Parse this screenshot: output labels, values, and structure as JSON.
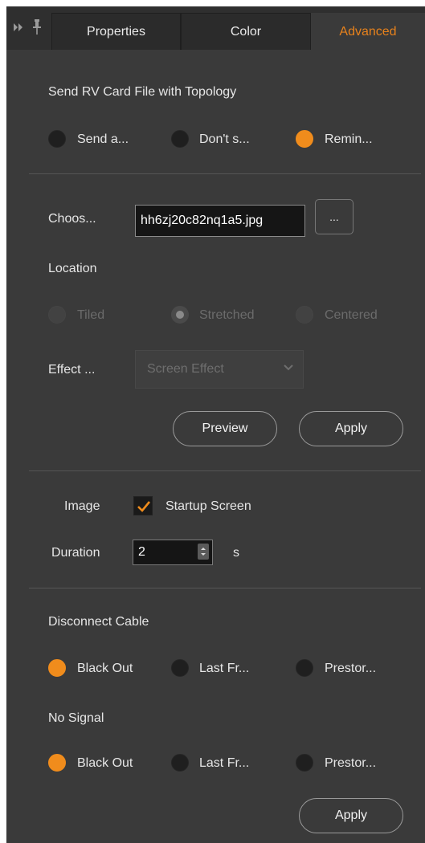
{
  "tabs": [
    {
      "label": "Properties"
    },
    {
      "label": "Color"
    },
    {
      "label": "Advanced"
    }
  ],
  "colors": {
    "accent": "#f08c1c",
    "panel": "#3a3a3a",
    "tab_active_text": "#e8821c"
  },
  "topology": {
    "heading": "Send RV Card File with Topology",
    "options": [
      {
        "label": "Send a...",
        "selected": false
      },
      {
        "label": "Don't s...",
        "selected": false
      },
      {
        "label": "Remin...",
        "selected": true
      }
    ]
  },
  "file": {
    "label": "Choos...",
    "value": "hh6zj20c82nq1a5.jpg",
    "browse_label": "..."
  },
  "location": {
    "heading": "Location",
    "options": [
      {
        "label": "Tiled",
        "selected": false,
        "enabled": false
      },
      {
        "label": "Stretched",
        "selected": true,
        "enabled": false
      },
      {
        "label": "Centered",
        "selected": false,
        "enabled": false
      }
    ]
  },
  "effect": {
    "label": "Effect ...",
    "selected": "Screen Effect"
  },
  "buttons": {
    "preview": "Preview",
    "apply": "Apply",
    "apply_bottom": "Apply"
  },
  "startup": {
    "image_label": "Image",
    "checkbox_label": "Startup Screen",
    "checked": true,
    "duration_label": "Duration",
    "duration_value": "2",
    "duration_unit": "s"
  },
  "disconnect": {
    "heading": "Disconnect Cable",
    "options": [
      {
        "label": "Black Out",
        "selected": true
      },
      {
        "label": "Last Fr...",
        "selected": false
      },
      {
        "label": "Prestor...",
        "selected": false
      }
    ]
  },
  "no_signal": {
    "heading": "No Signal",
    "options": [
      {
        "label": "Black Out",
        "selected": true
      },
      {
        "label": "Last Fr...",
        "selected": false
      },
      {
        "label": "Prestor...",
        "selected": false
      }
    ]
  }
}
